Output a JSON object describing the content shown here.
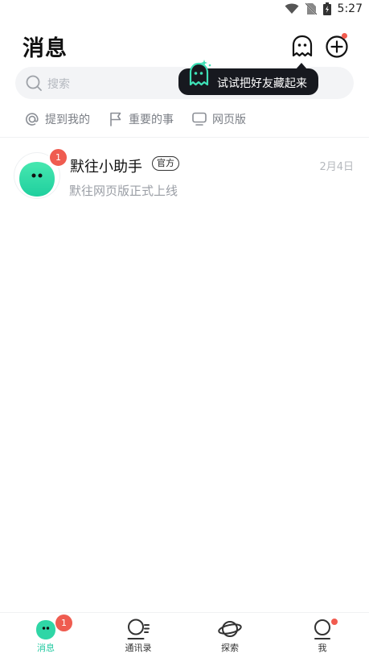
{
  "status_bar": {
    "time": "5:27"
  },
  "header": {
    "title": "消息"
  },
  "search": {
    "placeholder": "搜索"
  },
  "tooltip": {
    "text": "试试把好友藏起来"
  },
  "filters": [
    {
      "label": "提到我的",
      "icon": "at-icon"
    },
    {
      "label": "重要的事",
      "icon": "flag-icon"
    },
    {
      "label": "网页版",
      "icon": "monitor-icon"
    }
  ],
  "chats": [
    {
      "name": "默往小助手",
      "tag": "官方",
      "date": "2月4日",
      "preview": "默往网页版正式上线",
      "unread": "1"
    }
  ],
  "tabbar": {
    "tabs": [
      {
        "label": "消息",
        "badge": "1",
        "active": true
      },
      {
        "label": "通讯录"
      },
      {
        "label": "探索"
      },
      {
        "label": "我",
        "dot": true
      }
    ]
  },
  "colors": {
    "accent": "#21c9a0",
    "badge": "#ef5c50",
    "tooltip_bg": "#17191f"
  }
}
